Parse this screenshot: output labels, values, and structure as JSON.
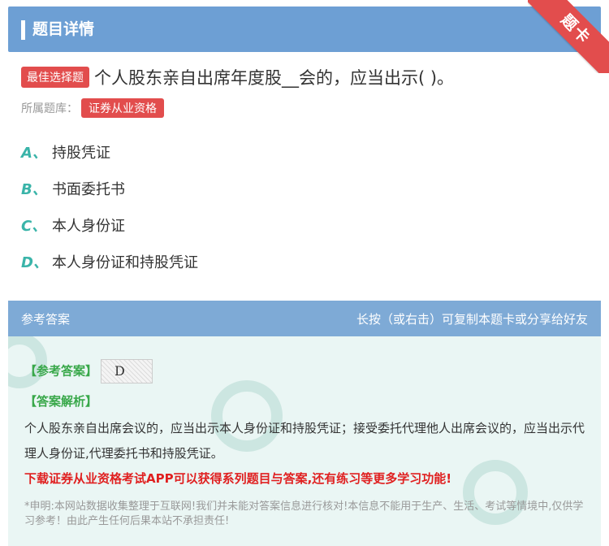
{
  "header": {
    "title": "题目详情",
    "ribbon": "题卡"
  },
  "question": {
    "tag": "最佳选择题",
    "text": "个人股东亲自出席年度股__会的，应当出示( )。",
    "library_label": "所属题库：",
    "library": "证券从业资格"
  },
  "options": [
    {
      "letter": "A、",
      "text": "持股凭证"
    },
    {
      "letter": "B、",
      "text": "书面委托书"
    },
    {
      "letter": "C、",
      "text": "本人身份证"
    },
    {
      "letter": "D、",
      "text": "本人身份证和持股凭证"
    }
  ],
  "answer": {
    "head_left": "参考答案",
    "head_right": "长按（或右击）可复制本题卡或分享给好友",
    "ref_label": "【参考答案】",
    "ref_value": "D",
    "analysis_label": "【答案解析】",
    "analysis_text": "个人股东亲自出席会议的，应当出示本人身份证和持股凭证；接受委托代理他人出席会议的，应当出示代理人身份证,代理委托书和持股凭证。",
    "promo": "下载证券从业资格考试APP可以获得系列题目与答案,还有练习等更多学习功能!",
    "disclaimer": "*申明:本网站数据收集整理于互联网!我们并未能对答案信息进行核对!本信息不能用于生产、生活、考试等情境中,仅供学习参考！由此产生任何后果本站不承担责任!"
  },
  "colors": {
    "header": "#6d9fd4",
    "accent_red": "#e24d4d",
    "option_letter": "#3ab4a9",
    "answer_bg": "#eaf6f4",
    "answer_head": "#7eaad6",
    "green": "#39a84a"
  }
}
